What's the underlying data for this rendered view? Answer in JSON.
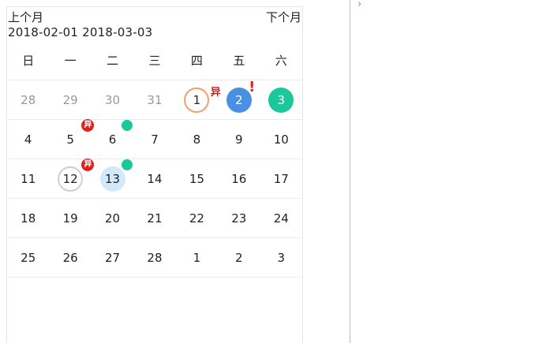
{
  "nav": {
    "prev_label": "上个月",
    "next_label": "下个月"
  },
  "range_text": "2018-02-01 2018-03-03",
  "weekdays": [
    "日",
    "一",
    "二",
    "三",
    "四",
    "五",
    "六"
  ],
  "weeks": [
    [
      {
        "day": "28",
        "muted": true
      },
      {
        "day": "29",
        "muted": true
      },
      {
        "day": "30",
        "muted": true
      },
      {
        "day": "31",
        "muted": true
      },
      {
        "day": "1",
        "style": "today",
        "badge": "text",
        "badge_text": "异"
      },
      {
        "day": "2",
        "style": "blue",
        "badge": "excl",
        "badge_text": "!"
      },
      {
        "day": "3",
        "style": "green"
      }
    ],
    [
      {
        "day": "4"
      },
      {
        "day": "5",
        "badge": "red",
        "badge_text": "异"
      },
      {
        "day": "6",
        "badge": "dot"
      },
      {
        "day": "7"
      },
      {
        "day": "8"
      },
      {
        "day": "9"
      },
      {
        "day": "10"
      }
    ],
    [
      {
        "day": "11"
      },
      {
        "day": "12",
        "style": "selected",
        "badge": "red",
        "badge_text": "异"
      },
      {
        "day": "13",
        "style": "light",
        "badge": "dot"
      },
      {
        "day": "14"
      },
      {
        "day": "15"
      },
      {
        "day": "16"
      },
      {
        "day": "17"
      }
    ],
    [
      {
        "day": "18"
      },
      {
        "day": "19"
      },
      {
        "day": "20"
      },
      {
        "day": "21"
      },
      {
        "day": "22"
      },
      {
        "day": "23"
      },
      {
        "day": "24"
      }
    ],
    [
      {
        "day": "25"
      },
      {
        "day": "26"
      },
      {
        "day": "27"
      },
      {
        "day": "28"
      },
      {
        "day": "1"
      },
      {
        "day": "2"
      },
      {
        "day": "3"
      }
    ]
  ],
  "colors": {
    "blue": "#4a90e2",
    "green": "#1cc79a",
    "light_blue": "#d2e8fb",
    "today_ring": "#f0a070",
    "alert_red": "#e0201a"
  },
  "icons": {
    "expand": "chevron-right-icon"
  }
}
